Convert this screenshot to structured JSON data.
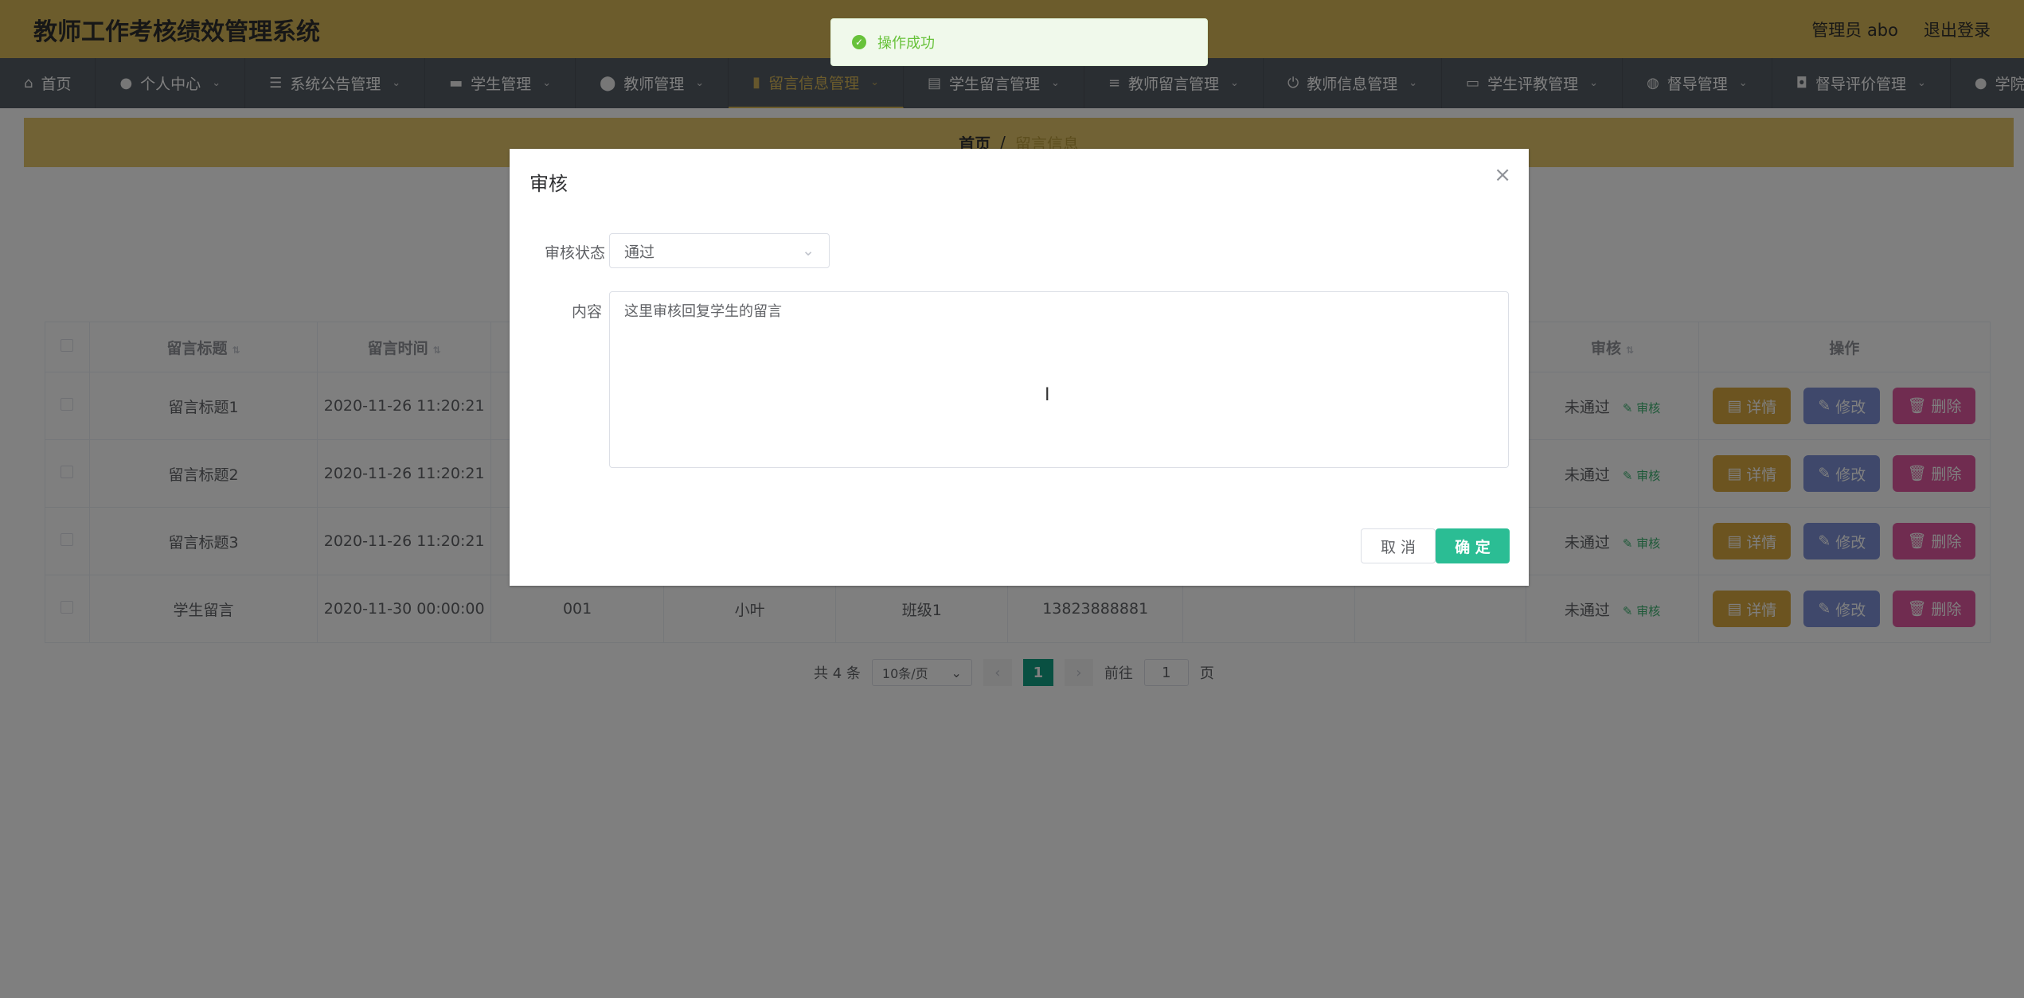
{
  "header": {
    "title": "教师工作考核绩效管理系统",
    "user": "管理员 abo",
    "logout": "退出登录"
  },
  "nav": [
    {
      "label": "首页",
      "icon": "home-icon",
      "active": false,
      "dropdown": false
    },
    {
      "label": "个人中心",
      "icon": "user-icon",
      "active": false,
      "dropdown": true
    },
    {
      "label": "系统公告管理",
      "icon": "sliders-icon",
      "active": false,
      "dropdown": true
    },
    {
      "label": "学生管理",
      "icon": "chat-icon",
      "active": false,
      "dropdown": true
    },
    {
      "label": "教师管理",
      "icon": "location-icon",
      "active": false,
      "dropdown": true
    },
    {
      "label": "留言信息管理",
      "icon": "bar-chart-icon",
      "active": true,
      "dropdown": true
    },
    {
      "label": "学生留言管理",
      "icon": "clipboard-icon",
      "active": false,
      "dropdown": true
    },
    {
      "label": "教师留言管理",
      "icon": "list-icon",
      "active": false,
      "dropdown": true
    },
    {
      "label": "教师信息管理",
      "icon": "power-icon",
      "active": false,
      "dropdown": true
    },
    {
      "label": "学生评教管理",
      "icon": "monitor-icon",
      "active": false,
      "dropdown": true
    },
    {
      "label": "督导管理",
      "icon": "globe-icon",
      "active": false,
      "dropdown": true
    },
    {
      "label": "督导评价管理",
      "icon": "camera-icon",
      "active": false,
      "dropdown": true
    },
    {
      "label": "学院管理",
      "icon": "user-icon",
      "active": false,
      "dropdown": true
    }
  ],
  "breadcrumb": {
    "home": "首页",
    "sep": "/",
    "current": "留言信息"
  },
  "table": {
    "headers": [
      "留言标题",
      "留言时间",
      "审核",
      "操作"
    ],
    "rows": [
      {
        "title": "留言标题1",
        "time": "2020-11-26 11:20:21",
        "c3": "",
        "c4": "",
        "c5": "",
        "c6": "",
        "c7": "",
        "status": "未通过",
        "audit": "审核"
      },
      {
        "title": "留言标题2",
        "time": "2020-11-26 11:20:21",
        "c3": "",
        "c4": "",
        "c5": "",
        "c6": "",
        "c7": "",
        "status": "未通过",
        "audit": "审核"
      },
      {
        "title": "留言标题3",
        "time": "2020-11-26 11:20:21",
        "c3": "",
        "c4": "",
        "c5": "",
        "c6": "",
        "c7": "",
        "status": "未通过",
        "audit": "审核"
      },
      {
        "title": "学生留言",
        "time": "2020-11-30 00:00:00",
        "c3": "001",
        "c4": "小叶",
        "c5": "班级1",
        "c6": "13823888881",
        "c7": "",
        "status": "未通过",
        "audit": "审核"
      }
    ],
    "actions": {
      "detail": "详情",
      "edit": "修改",
      "delete": "删除"
    }
  },
  "pagination": {
    "total": "共 4 条",
    "size": "10条/页",
    "page": "1",
    "goto": "前往",
    "goto_value": "1",
    "page_unit": "页"
  },
  "dialog": {
    "title": "审核",
    "status_label": "审核状态",
    "status_value": "通过",
    "content_label": "内容",
    "content_value": "这里审核回复学生的留言",
    "cancel": "取 消",
    "confirm": "确 定"
  },
  "toast": {
    "message": "操作成功"
  },
  "colors": {
    "header": "#d9b859",
    "nav": "#545c64",
    "accent": "#12a085",
    "confirm": "#2bbd94"
  }
}
